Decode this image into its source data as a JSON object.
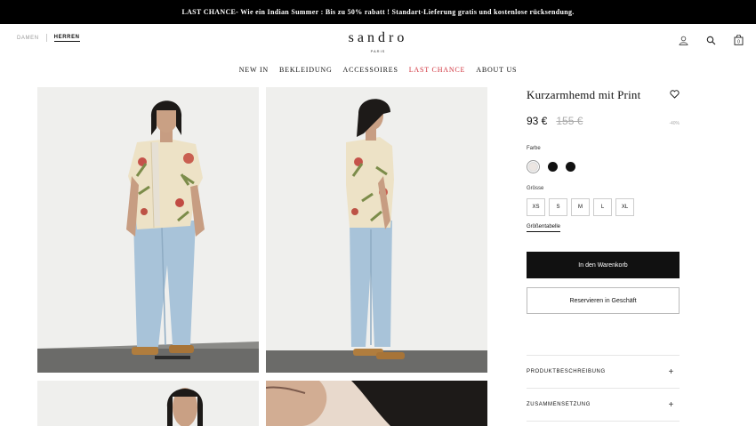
{
  "promo": "LAST CHANCE- Wie ein Indian Summer : Bis zu 50% rabatt ! Standart-Lieferung gratis und kostenlose rücksendung.",
  "gender": {
    "damen": "DAMEN",
    "herren": "HERREN"
  },
  "brand": {
    "name": "sandro",
    "sub": "PARIS"
  },
  "header_icons": [
    "account-icon",
    "search-icon",
    "bag-icon"
  ],
  "cart_count": "0",
  "nav": [
    "NEW IN",
    "BEKLEIDUNG",
    "ACCESSOIRES",
    "LAST CHANCE",
    "ABOUT US"
  ],
  "product": {
    "title": "Kurzarmhemd mit Print",
    "price": "93 €",
    "old_price": "155 €",
    "discount": "-40%",
    "color_label": "Farbe",
    "colors": [
      "#ece6e2",
      "#111111",
      "#111111"
    ],
    "size_label": "Grösse",
    "sizes": [
      "XS",
      "S",
      "M",
      "L",
      "XL"
    ],
    "size_chart": "Größentabelle",
    "add_to_cart": "In den Warenkorb",
    "reserve": "Reservieren in Geschäft",
    "accordion": [
      "PRODUKTBESCHREIBUNG",
      "ZUSAMMENSETZUNG"
    ]
  }
}
